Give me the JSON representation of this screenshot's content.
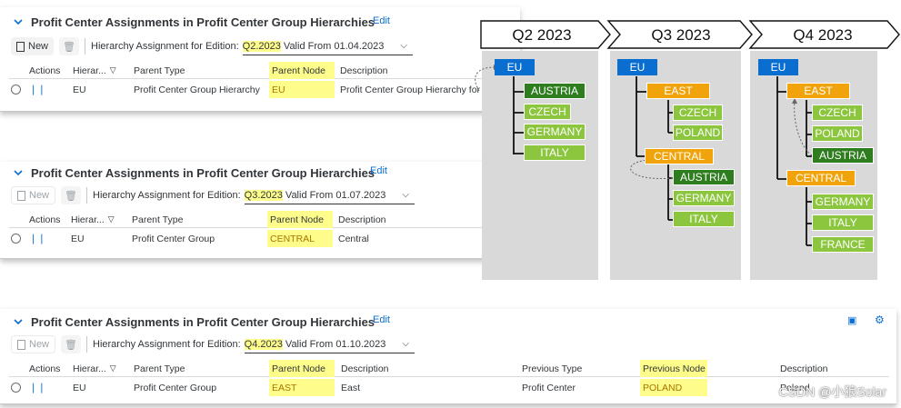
{
  "panels": [
    {
      "title": "Profit Center Assignments in Profit Center Group Hierarchies",
      "edit": "Edit",
      "new": "New",
      "hierarchy_label": "Hierarchy Assignment for Edition:",
      "edition": "Q2.2023",
      "valid_from": "Valid From 01.04.2023",
      "headers": [
        "Actions",
        "Hierar...",
        "Parent Type",
        "Parent Node",
        "Description"
      ],
      "row": {
        "hierarchy": "EU",
        "parent_type": "Profit Center Group Hierarchy",
        "parent_node": "EU",
        "description": "Profit Center Group Hierarchy for E"
      }
    },
    {
      "title": "Profit Center Assignments in Profit Center Group Hierarchies",
      "edit": "Edit",
      "new": "New",
      "hierarchy_label": "Hierarchy Assignment for Edition:",
      "edition": "Q3.2023",
      "valid_from": "Valid From 01.07.2023",
      "headers": [
        "Actions",
        "Hierar...",
        "Parent Type",
        "Parent Node",
        "Description"
      ],
      "row": {
        "hierarchy": "EU",
        "parent_type": "Profit Center Group",
        "parent_node": "CENTRAL",
        "description": "Central"
      }
    },
    {
      "title": "Profit Center Assignments in Profit Center Group Hierarchies",
      "edit": "Edit",
      "new": "New",
      "hierarchy_label": "Hierarchy Assignment for Edition:",
      "edition": "Q4.2023",
      "valid_from": "Valid From 01.10.2023",
      "headers": [
        "Actions",
        "Hierar...",
        "Parent Type",
        "Parent Node",
        "Description",
        "Previous Type",
        "Previous Node",
        "Description"
      ],
      "row": {
        "hierarchy": "EU",
        "parent_type": "Profit Center Group",
        "parent_node": "EAST",
        "description": "East",
        "previous_type": "Profit Center",
        "previous_node": "POLAND",
        "previous_description": "Poland"
      }
    }
  ],
  "diagram": {
    "phases": [
      "Q2 2023",
      "Q3 2023",
      "Q4 2023"
    ],
    "q2": {
      "root": "EU",
      "children": [
        "AUSTRIA",
        "CZECH",
        "GERMANY",
        "ITALY"
      ]
    },
    "q3": {
      "root": "EU",
      "east": "EAST",
      "east_children": [
        "CZECH",
        "POLAND"
      ],
      "central": "CENTRAL",
      "central_children": [
        "AUSTRIA",
        "GERMANY",
        "ITALY"
      ]
    },
    "q4": {
      "root": "EU",
      "east": "EAST",
      "east_children": [
        "CZECH",
        "POLAND",
        "AUSTRIA"
      ],
      "central": "CENTRAL",
      "central_children": [
        "GERMANY",
        "ITALY",
        "FRANCE"
      ]
    }
  },
  "watermark": "CSDN @小狼Solar",
  "colors": {
    "accent": "#0a6ed1",
    "highlight": "#fefc8a",
    "dark_green": "#2e7d1f",
    "light_green": "#8cc63e",
    "orange": "#f0a30a"
  }
}
